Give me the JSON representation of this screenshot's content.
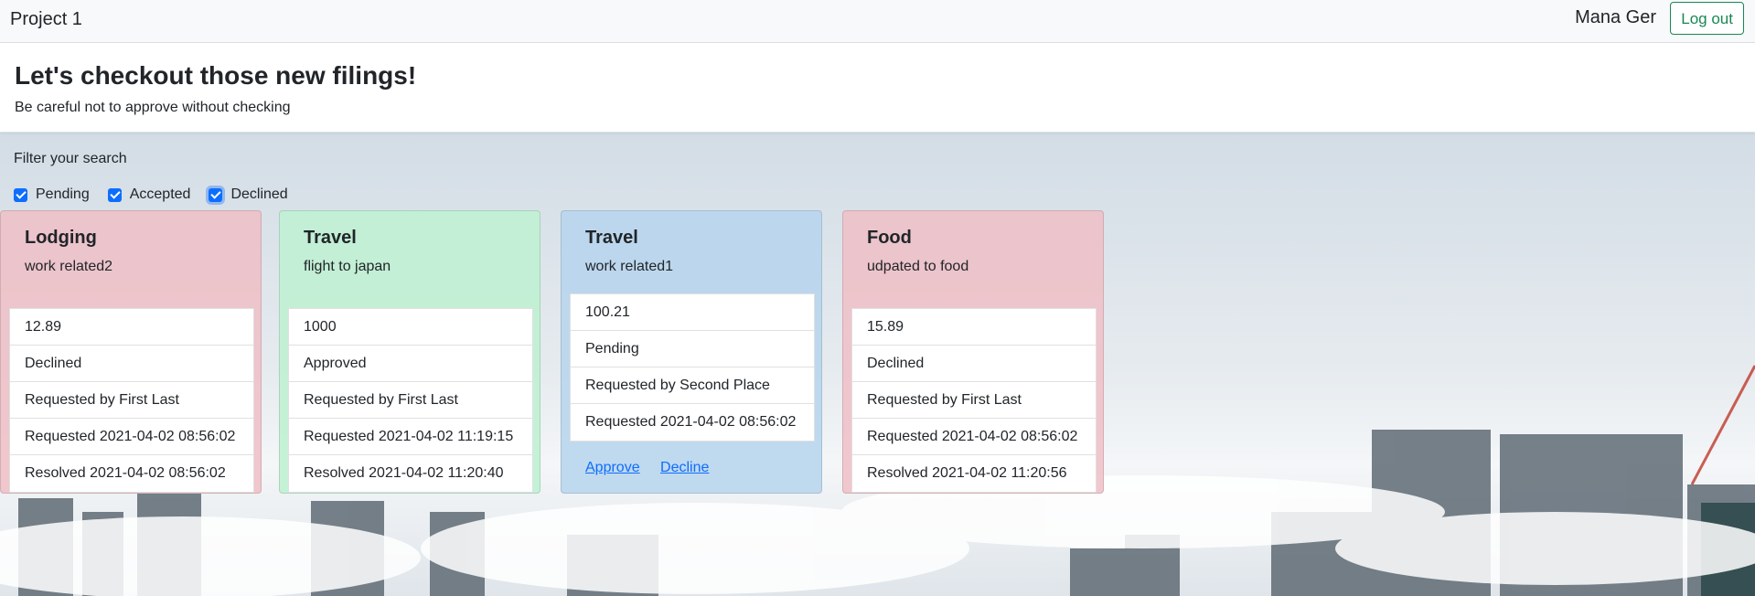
{
  "navbar": {
    "brand": "Project 1",
    "username": "Mana Ger",
    "logout_label": "Log out"
  },
  "header": {
    "title": "Let's checkout those new filings!",
    "subtitle": "Be careful not to approve without checking"
  },
  "filter": {
    "label": "Filter your search",
    "options": [
      {
        "label": "Pending",
        "checked": true
      },
      {
        "label": "Accepted",
        "checked": true
      },
      {
        "label": "Declined",
        "checked": true
      }
    ]
  },
  "cards": [
    {
      "category": "Lodging",
      "description": "work related2",
      "color": "#efbec5",
      "items": [
        "12.89",
        "Declined",
        "Requested by First Last",
        "Requested 2021-04-02 08:56:02",
        "Resolved 2021-04-02 08:56:02"
      ]
    },
    {
      "category": "Travel",
      "description": "flight to japan",
      "color": "#bef0d2",
      "items": [
        "1000",
        "Approved",
        "Requested by First Last",
        "Requested 2021-04-02 11:19:15",
        "Resolved 2021-04-02 11:20:40"
      ]
    },
    {
      "category": "Travel",
      "description": "work related1",
      "color": "#b7d5ed",
      "items": [
        "100.21",
        "Pending",
        "Requested by Second Place",
        "Requested 2021-04-02 08:56:02"
      ],
      "actions": {
        "approve": "Approve",
        "decline": "Decline"
      }
    },
    {
      "category": "Food",
      "description": "udpated to food",
      "color": "#efbec5",
      "items": [
        "15.89",
        "Declined",
        "Requested by First Last",
        "Requested 2021-04-02 08:56:02",
        "Resolved 2021-04-02 11:20:56"
      ]
    }
  ]
}
